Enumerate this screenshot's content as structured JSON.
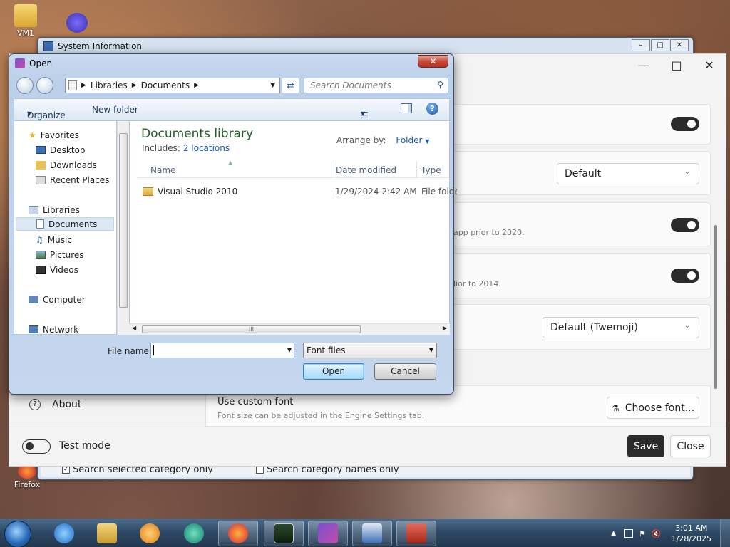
{
  "desktop": {
    "icons": [
      {
        "label": "VM1",
        "icon": "folder-user-icon"
      },
      {
        "label": "",
        "icon": "infinity-shortcut-icon"
      },
      {
        "label": "Firefox",
        "icon": "firefox-shortcut-icon"
      }
    ]
  },
  "sysinfo_window": {
    "title": "System Information",
    "search_selected_category_label": "Search selected category only",
    "search_category_names_label": "Search category names only",
    "search_selected_checked": "✓"
  },
  "settings_window": {
    "dropdown_1_value": "Default",
    "row3_desc": "app prior to 2020.",
    "row4_desc": "lior to 2014.",
    "emoji_dropdown_value": "Default (Twemoji)",
    "about_label": "About",
    "custom_font_title": "Use custom font",
    "custom_font_desc": "Font size can be adjusted in the Engine Settings tab.",
    "choose_font_label": "Choose font...",
    "test_mode_label": "Test mode",
    "save_label": "Save",
    "close_label": "Close"
  },
  "open_dialog": {
    "title": "Open",
    "address": {
      "crumbs": [
        "Libraries",
        "Documents"
      ]
    },
    "search_placeholder": "Search Documents",
    "toolbar": {
      "organize": "Organize",
      "new_folder": "New folder"
    },
    "nav": {
      "favorites": "Favorites",
      "desktop": "Desktop",
      "downloads": "Downloads",
      "recent_places": "Recent Places",
      "libraries": "Libraries",
      "documents": "Documents",
      "music": "Music",
      "pictures": "Pictures",
      "videos": "Videos",
      "computer": "Computer",
      "network": "Network"
    },
    "library_title": "Documents library",
    "includes_label": "Includes:",
    "includes_link": "2 locations",
    "arrange_by_label": "Arrange by:",
    "arrange_by_value": "Folder",
    "columns": {
      "name": "Name",
      "date_modified": "Date modified",
      "type": "Type"
    },
    "files": [
      {
        "name": "Visual Studio 2010",
        "date": "1/29/2024 2:42 AM",
        "type": "File folder"
      }
    ],
    "hscroll_grip": "III",
    "file_name_label": "File name:",
    "file_name_value": "",
    "file_type_value": "Font files",
    "open_button": "Open",
    "cancel_button": "Cancel"
  },
  "taskbar": {
    "time": "3:01 AM",
    "date": "1/28/2025"
  }
}
